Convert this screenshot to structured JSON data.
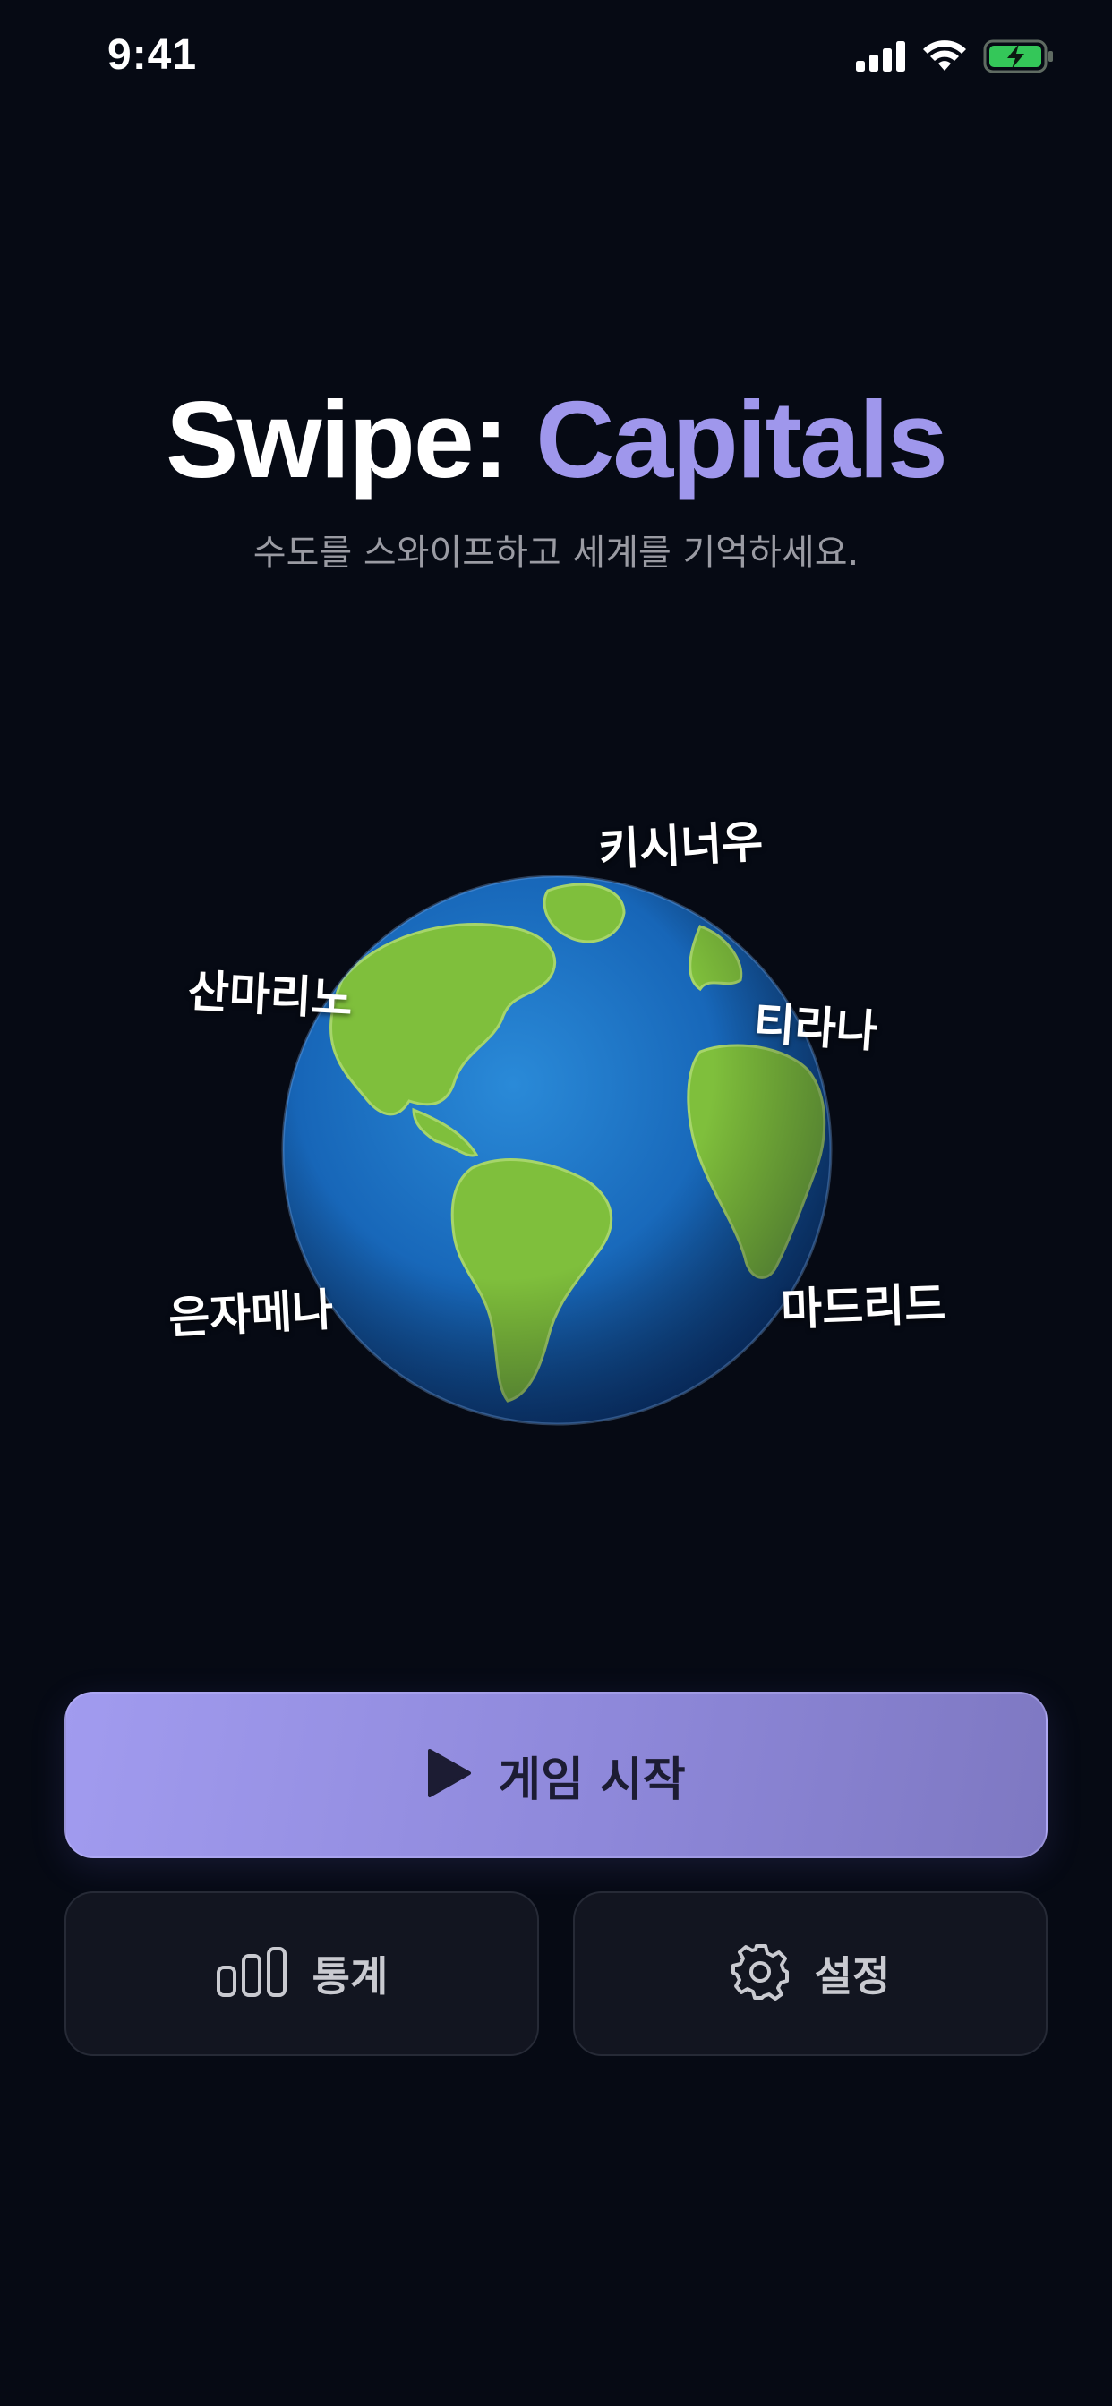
{
  "status_bar": {
    "time": "9:41",
    "icons": [
      "signal-icon",
      "wifi-icon",
      "battery-charging-icon"
    ],
    "battery_color": "#34c759"
  },
  "header": {
    "title_part1": "Swipe:",
    "title_part2": "Capitals",
    "subtitle": "수도를 스와이프하고 세계를 기억하세요.",
    "accent_color": "#9f97ec"
  },
  "globe": {
    "icon": "globe-icon",
    "capitals": [
      "키시너우",
      "산마리노",
      "티라나",
      "은자메나",
      "마드리드"
    ]
  },
  "actions": {
    "start": {
      "label": "게임 시작",
      "icon": "play-icon"
    },
    "stats": {
      "label": "통계",
      "icon": "bar-chart-icon"
    },
    "settings": {
      "label": "설정",
      "icon": "gear-icon"
    }
  }
}
